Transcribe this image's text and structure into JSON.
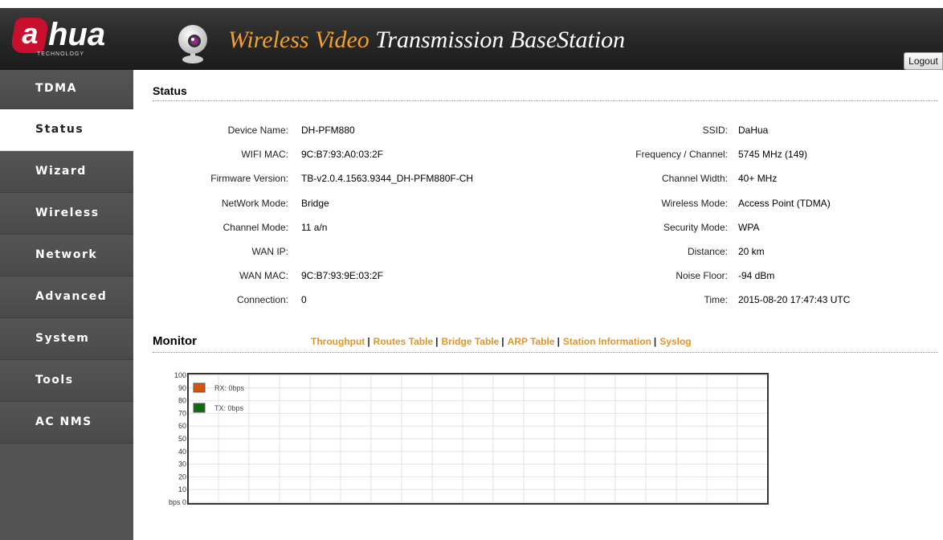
{
  "header": {
    "logo_a": "a",
    "logo_hua": "hua",
    "logo_tech": "TECHNOLOGY",
    "title_wireless": "Wireless",
    "title_video": " Video",
    "title_rest": " Transmission BaseStation",
    "logout_label": "Logout"
  },
  "sidebar": {
    "items": [
      {
        "label": "TDMA"
      },
      {
        "label": "Status"
      },
      {
        "label": "Wizard"
      },
      {
        "label": "Wireless"
      },
      {
        "label": "Network"
      },
      {
        "label": "Advanced"
      },
      {
        "label": "System"
      },
      {
        "label": "Tools"
      },
      {
        "label": "AC NMS"
      }
    ],
    "active": "Status"
  },
  "status": {
    "title": "Status",
    "left": [
      {
        "label": "Device Name:",
        "value": "DH-PFM880"
      },
      {
        "label": "WIFI MAC:",
        "value": "9C:B7:93:A0:03:2F"
      },
      {
        "label": "Firmware Version:",
        "value": "TB-v2.0.4.1563.9344_DH-PFM880F-CH"
      },
      {
        "label": "NetWork Mode:",
        "value": "Bridge"
      },
      {
        "label": "Channel Mode:",
        "value": "11 a/n"
      },
      {
        "label": "WAN IP:",
        "value": ""
      },
      {
        "label": "WAN MAC:",
        "value": "9C:B7:93:9E:03:2F"
      },
      {
        "label": "Connection:",
        "value": "0"
      }
    ],
    "right": [
      {
        "label": "SSID:",
        "value": "DaHua"
      },
      {
        "label": "Frequency / Channel:",
        "value": "5745 MHz (149)"
      },
      {
        "label": "Channel Width:",
        "value": "40+ MHz"
      },
      {
        "label": "Wireless Mode:",
        "value": "Access Point (TDMA)"
      },
      {
        "label": "Security Mode:",
        "value": "WPA"
      },
      {
        "label": "Distance:",
        "value": "20 km"
      },
      {
        "label": "Noise Floor:",
        "value": "-94 dBm"
      },
      {
        "label": "Time:",
        "value": "2015-08-20 17:47:43 UTC"
      }
    ]
  },
  "monitor": {
    "title": "Monitor",
    "links": [
      "Throughput",
      "Routes Table",
      "Bridge Table",
      "ARP Table",
      "Station Information",
      "Syslog"
    ],
    "separator": "|"
  },
  "colors": {
    "accent": "#e0962a",
    "rx": "#d4560a",
    "tx": "#0e6b0e"
  },
  "chart_data": {
    "type": "line",
    "ylim": [
      0,
      100
    ],
    "y_ticks": [
      "100",
      "90",
      "80",
      "70",
      "60",
      "50",
      "40",
      "30",
      "20",
      "10",
      "bps 0"
    ],
    "grid": true,
    "legend_position": "top-left",
    "series": [
      {
        "name": "RX: 0bps",
        "color": "#d4560a",
        "values": []
      },
      {
        "name": "TX: 0bps",
        "color": "#0e6b0e",
        "values": []
      }
    ]
  }
}
